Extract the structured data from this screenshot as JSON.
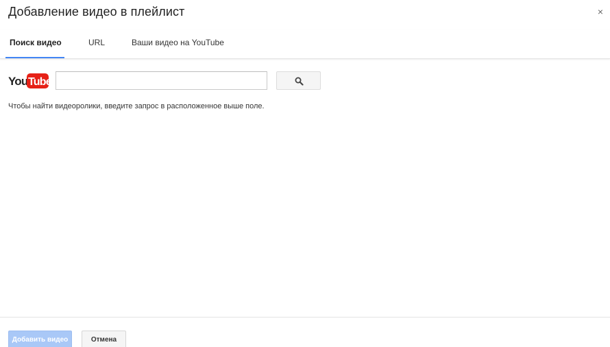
{
  "dialog": {
    "title": "Добавление видео в плейлист",
    "close_label": "×"
  },
  "tabs": [
    {
      "label": "Поиск видео",
      "active": true
    },
    {
      "label": "URL",
      "active": false
    },
    {
      "label": "Ваши видео на YouTube",
      "active": false
    }
  ],
  "search": {
    "logo_you": "You",
    "logo_tube": "Tube",
    "input_value": "",
    "input_placeholder": "",
    "button_icon": "search-icon",
    "hint": "Чтобы найти видеоролики, введите запрос в расположенное выше поле."
  },
  "footer": {
    "add_label": "Добавить видео",
    "cancel_label": "Отмена"
  },
  "colors": {
    "accent": "#4285f4",
    "youtube_red": "#e62117",
    "add_button_disabled": "#a9c8f7"
  }
}
